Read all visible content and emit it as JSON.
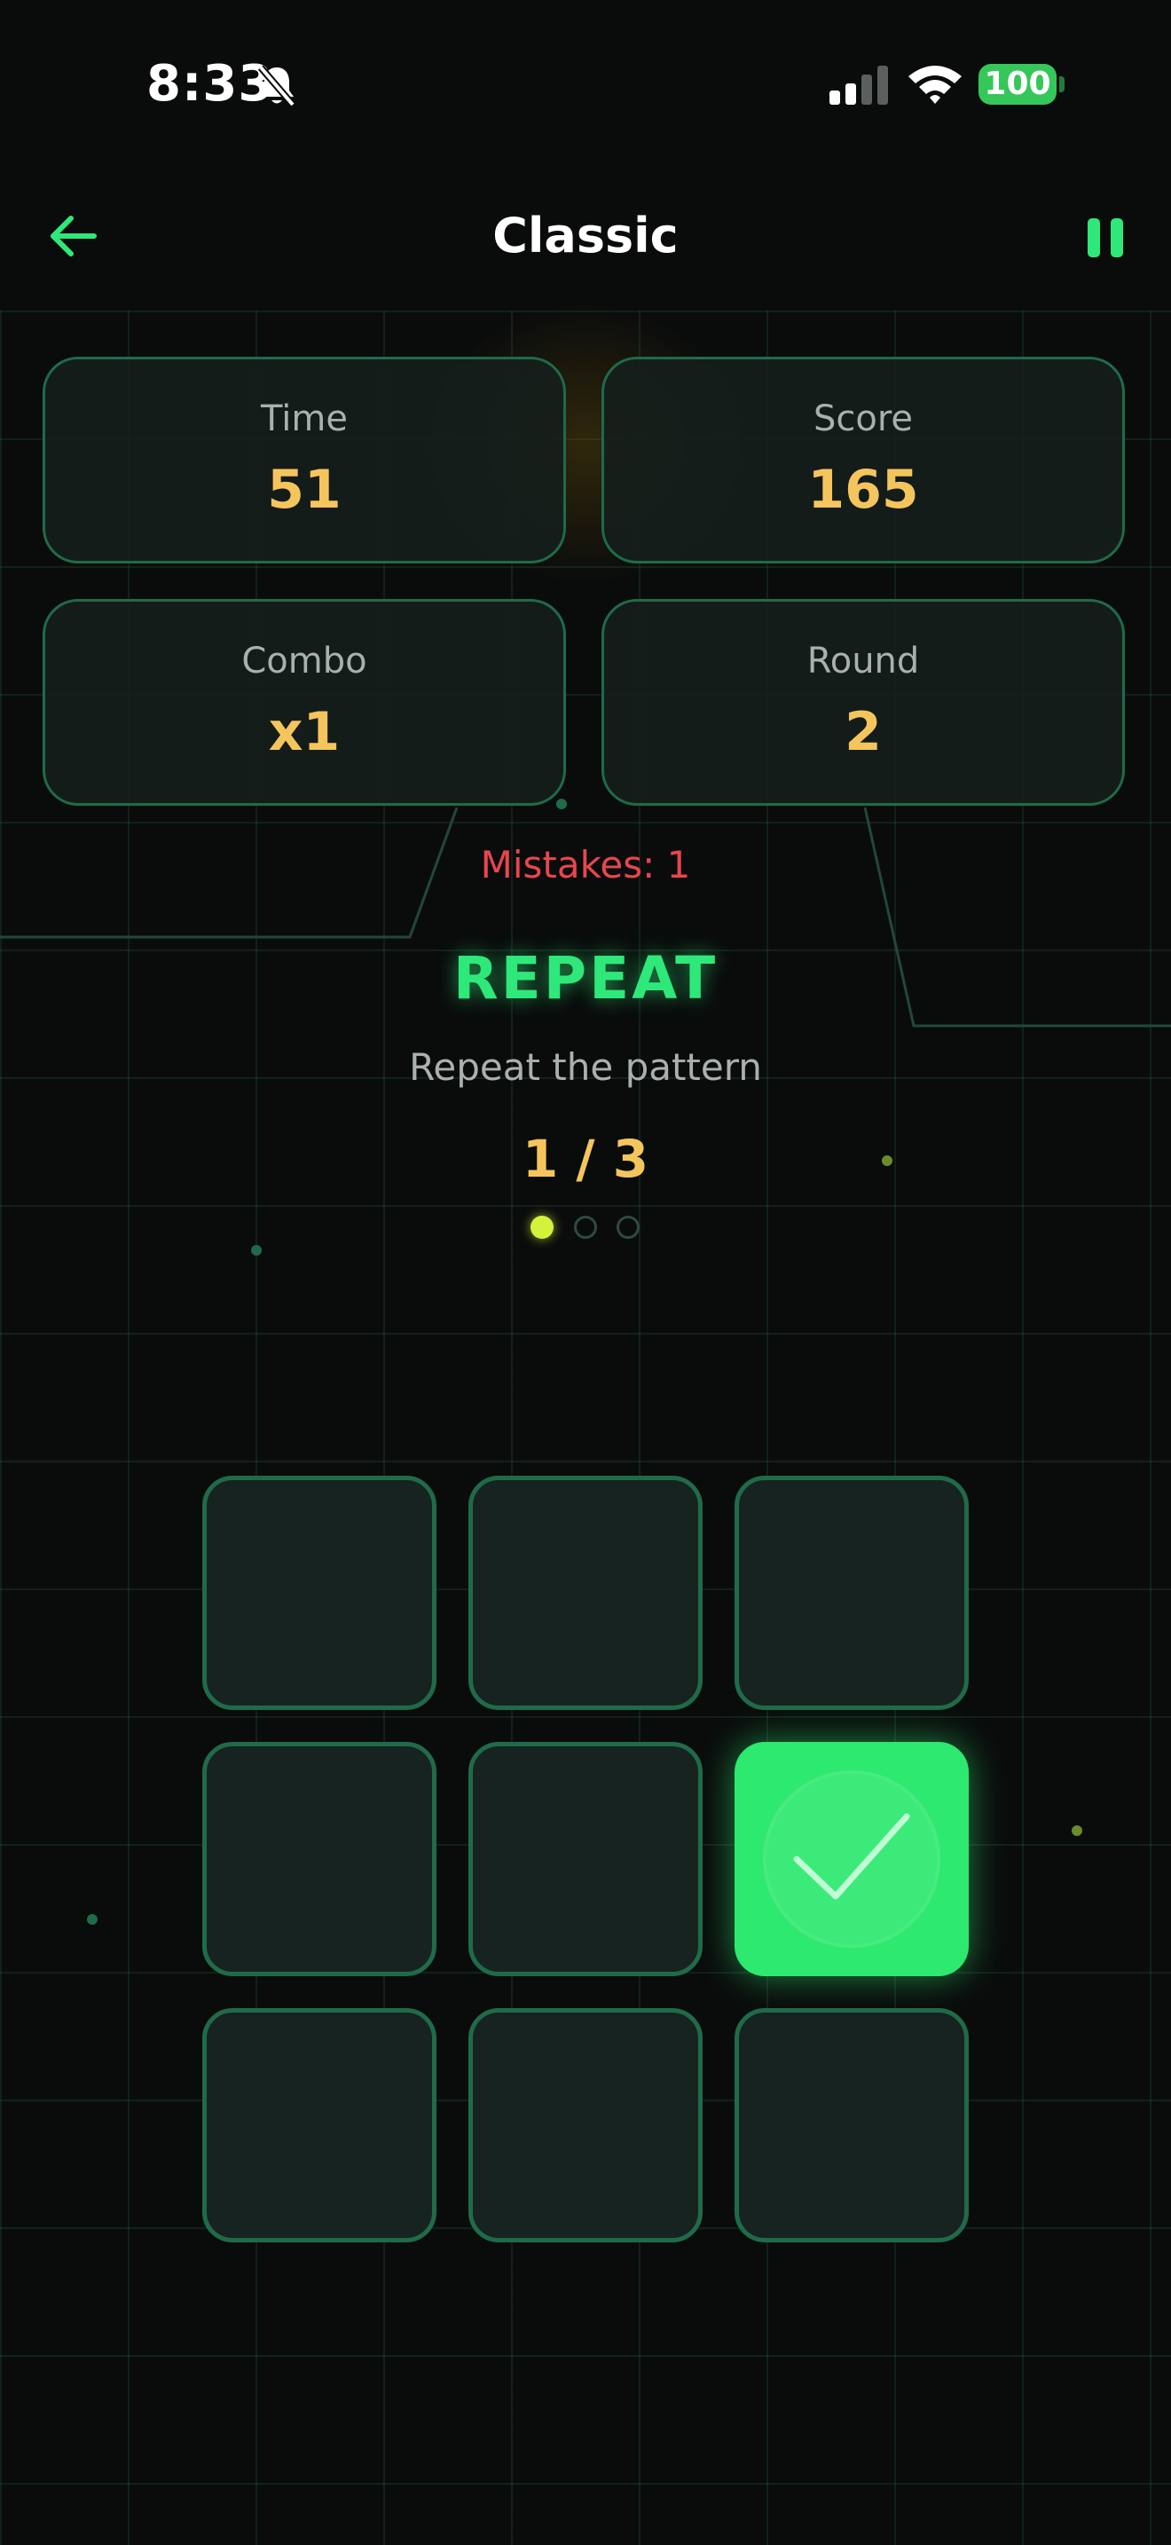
{
  "status_bar": {
    "time": "8:33",
    "battery": "100"
  },
  "header": {
    "title": "Classic"
  },
  "stats": [
    {
      "label": "Time",
      "value": "51"
    },
    {
      "label": "Score",
      "value": "165"
    },
    {
      "label": "Combo",
      "value": "x1"
    },
    {
      "label": "Round",
      "value": "2"
    }
  ],
  "mistakes": "Mistakes: 1",
  "phase": {
    "title": "REPEAT",
    "instruction": "Repeat the pattern"
  },
  "progress": {
    "text": "1 / 3",
    "current": 1,
    "total": 3
  },
  "grid": {
    "rows": 3,
    "cols": 3,
    "active_tile": {
      "row": 2,
      "col": 3,
      "state": "correct"
    }
  },
  "colors": {
    "accent": "#2ee87a",
    "stat_value": "#f5c55d",
    "mistakes": "#e8464e",
    "tile_border": "#1f6b49",
    "active_tile": "#2ee96f"
  },
  "icons": {
    "back": "arrow-left-icon",
    "pause": "pause-icon",
    "silent": "bell-slash-icon",
    "correct": "checkmark-icon"
  }
}
